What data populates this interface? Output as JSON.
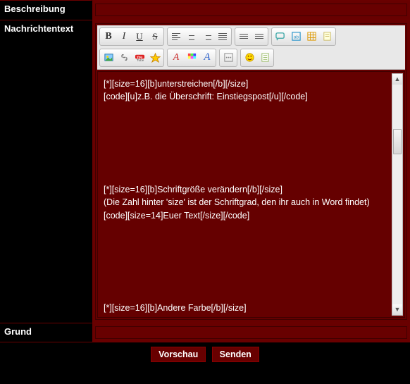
{
  "labels": {
    "beschreibung": "Beschreibung",
    "nachrichtentext": "Nachrichtentext",
    "grund": "Grund"
  },
  "fields": {
    "beschreibung_value": "",
    "grund_value": ""
  },
  "toolbar": {
    "bold": "B",
    "italic": "I",
    "underline": "U",
    "strike": "S"
  },
  "editor": {
    "content": "[*][size=16][b]unterstreichen[/b][/size]\n[code][u]z.B. die Überschrift: Einstiegspost[/u][/code]\n\n\n\n\n\n\n[*][size=16][b]Schriftgröße verändern[/b][/size]\n(Die Zahl hinter 'size' ist der Schriftgrad, den ihr auch in Word findet)\n[code][size=14]Euer Text[/size][/code]\n\n\n\n\n\n\n[*][size=16][b]Andere Farbe[/b][/size]"
  },
  "buttons": {
    "preview": "Vorschau",
    "submit": "Senden"
  }
}
